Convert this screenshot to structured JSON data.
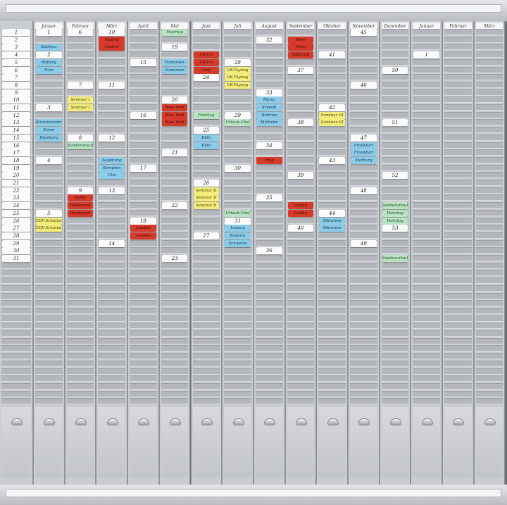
{
  "months": [
    "Januar",
    "Februar",
    "März",
    "April",
    "Mai",
    "Juni",
    "Juli",
    "August",
    "September",
    "Oktober",
    "November",
    "Dezember",
    "Januar",
    "Februar",
    "März"
  ],
  "days": [
    "1",
    "2",
    "3",
    "4",
    "5",
    "6",
    "7",
    "8",
    "9",
    "10",
    "11",
    "12",
    "13",
    "14",
    "15",
    "16",
    "17",
    "18",
    "19",
    "20",
    "21",
    "22",
    "23",
    "24",
    "25",
    "26",
    "27",
    "28",
    "29",
    "30",
    "31"
  ],
  "cards": [
    {
      "col": 0,
      "row": 0,
      "text": "1",
      "color": "white"
    },
    {
      "col": 0,
      "row": 2,
      "text": "Koblenz",
      "color": "blue"
    },
    {
      "col": 0,
      "row": 3,
      "text": "2",
      "color": "white"
    },
    {
      "col": 0,
      "row": 4,
      "text": "Bitburg",
      "color": "blue"
    },
    {
      "col": 0,
      "row": 5,
      "text": "Trier",
      "color": "blue"
    },
    {
      "col": 0,
      "row": 10,
      "text": "3",
      "color": "white"
    },
    {
      "col": 0,
      "row": 12,
      "text": "Kaiserslautern",
      "color": "blue"
    },
    {
      "col": 0,
      "row": 13,
      "text": "Essen",
      "color": "blue"
    },
    {
      "col": 0,
      "row": 14,
      "text": "Duisburg",
      "color": "blue"
    },
    {
      "col": 0,
      "row": 17,
      "text": "4",
      "color": "white"
    },
    {
      "col": 0,
      "row": 24,
      "text": "5",
      "color": "white"
    },
    {
      "col": 0,
      "row": 25,
      "text": "EDV-Schulung",
      "color": "yellow"
    },
    {
      "col": 0,
      "row": 26,
      "text": "EDV-Schulung",
      "color": "yellow"
    },
    {
      "col": 1,
      "row": 0,
      "text": "6",
      "color": "white"
    },
    {
      "col": 1,
      "row": 7,
      "text": "7",
      "color": "white"
    },
    {
      "col": 1,
      "row": 9,
      "text": "Seminar I",
      "color": "yellow"
    },
    {
      "col": 1,
      "row": 10,
      "text": "Seminar I",
      "color": "yellow"
    },
    {
      "col": 1,
      "row": 14,
      "text": "8",
      "color": "white"
    },
    {
      "col": 1,
      "row": 15,
      "text": "Sonderurlaub",
      "color": "green"
    },
    {
      "col": 1,
      "row": 21,
      "text": "9",
      "color": "white"
    },
    {
      "col": 1,
      "row": 22,
      "text": "Venlo",
      "color": "red"
    },
    {
      "col": 1,
      "row": 23,
      "text": "Roermond",
      "color": "red"
    },
    {
      "col": 1,
      "row": 24,
      "text": "Roermond",
      "color": "red"
    },
    {
      "col": 2,
      "row": 0,
      "text": "10",
      "color": "white"
    },
    {
      "col": 2,
      "row": 1,
      "text": "Madrid",
      "color": "red"
    },
    {
      "col": 2,
      "row": 2,
      "text": "Madrid",
      "color": "red"
    },
    {
      "col": 2,
      "row": 7,
      "text": "11",
      "color": "white"
    },
    {
      "col": 2,
      "row": 14,
      "text": "12",
      "color": "white"
    },
    {
      "col": 2,
      "row": 17,
      "text": "Augsburg",
      "color": "blue"
    },
    {
      "col": 2,
      "row": 18,
      "text": "Kempten",
      "color": "blue"
    },
    {
      "col": 2,
      "row": 19,
      "text": "Ulm",
      "color": "blue"
    },
    {
      "col": 2,
      "row": 21,
      "text": "13",
      "color": "white"
    },
    {
      "col": 2,
      "row": 28,
      "text": "14",
      "color": "white"
    },
    {
      "col": 3,
      "row": 4,
      "text": "15",
      "color": "white"
    },
    {
      "col": 3,
      "row": 11,
      "text": "16",
      "color": "white"
    },
    {
      "col": 3,
      "row": 18,
      "text": "17",
      "color": "white"
    },
    {
      "col": 3,
      "row": 25,
      "text": "18",
      "color": "white"
    },
    {
      "col": 3,
      "row": 26,
      "text": "London",
      "color": "red"
    },
    {
      "col": 3,
      "row": 27,
      "text": "London",
      "color": "red"
    },
    {
      "col": 4,
      "row": 0,
      "text": "Feiertag",
      "color": "green"
    },
    {
      "col": 4,
      "row": 2,
      "text": "19",
      "color": "white"
    },
    {
      "col": 4,
      "row": 4,
      "text": "Hannover",
      "color": "blue"
    },
    {
      "col": 4,
      "row": 5,
      "text": "Hannover",
      "color": "blue"
    },
    {
      "col": 4,
      "row": 9,
      "text": "20",
      "color": "white"
    },
    {
      "col": 4,
      "row": 10,
      "text": "New York",
      "color": "red"
    },
    {
      "col": 4,
      "row": 11,
      "text": "New York",
      "color": "red"
    },
    {
      "col": 4,
      "row": 12,
      "text": "New York",
      "color": "red"
    },
    {
      "col": 4,
      "row": 16,
      "text": "21",
      "color": "white"
    },
    {
      "col": 4,
      "row": 23,
      "text": "22",
      "color": "white"
    },
    {
      "col": 4,
      "row": 30,
      "text": "23",
      "color": "white"
    },
    {
      "col": 5,
      "row": 3,
      "text": "Zürich",
      "color": "red"
    },
    {
      "col": 5,
      "row": 4,
      "text": "Zürich",
      "color": "red"
    },
    {
      "col": 5,
      "row": 5,
      "text": "Genf",
      "color": "red"
    },
    {
      "col": 5,
      "row": 6,
      "text": "24",
      "color": "white"
    },
    {
      "col": 5,
      "row": 11,
      "text": "Feiertag",
      "color": "green"
    },
    {
      "col": 5,
      "row": 13,
      "text": "25",
      "color": "white"
    },
    {
      "col": 5,
      "row": 14,
      "text": "Köln",
      "color": "blue"
    },
    {
      "col": 5,
      "row": 15,
      "text": "Köln",
      "color": "blue"
    },
    {
      "col": 5,
      "row": 20,
      "text": "26",
      "color": "white"
    },
    {
      "col": 5,
      "row": 21,
      "text": "Seminar II",
      "color": "yellow"
    },
    {
      "col": 5,
      "row": 22,
      "text": "Seminar II",
      "color": "yellow"
    },
    {
      "col": 5,
      "row": 23,
      "text": "Seminar II",
      "color": "yellow"
    },
    {
      "col": 5,
      "row": 27,
      "text": "27",
      "color": "white"
    },
    {
      "col": 6,
      "row": 4,
      "text": "28",
      "color": "white"
    },
    {
      "col": 6,
      "row": 5,
      "text": "VK-Tagung",
      "color": "yellow"
    },
    {
      "col": 6,
      "row": 6,
      "text": "VK-Tagung",
      "color": "yellow"
    },
    {
      "col": 6,
      "row": 7,
      "text": "VK-Tagung",
      "color": "yellow"
    },
    {
      "col": 6,
      "row": 11,
      "text": "29",
      "color": "white"
    },
    {
      "col": 6,
      "row": 12,
      "text": "Urlaub-Chef",
      "color": "green"
    },
    {
      "col": 6,
      "row": 18,
      "text": "30",
      "color": "white"
    },
    {
      "col": 6,
      "row": 24,
      "text": "Urlaub-Chef",
      "color": "green"
    },
    {
      "col": 6,
      "row": 25,
      "text": "31",
      "color": "white"
    },
    {
      "col": 6,
      "row": 26,
      "text": "Leipzig",
      "color": "blue"
    },
    {
      "col": 6,
      "row": 27,
      "text": "Rostock",
      "color": "blue"
    },
    {
      "col": 6,
      "row": 28,
      "text": "Schwerin",
      "color": "blue"
    },
    {
      "col": 7,
      "row": 1,
      "text": "32",
      "color": "white"
    },
    {
      "col": 7,
      "row": 8,
      "text": "33",
      "color": "white"
    },
    {
      "col": 7,
      "row": 9,
      "text": "Mainz",
      "color": "blue"
    },
    {
      "col": 7,
      "row": 10,
      "text": "Krefeld",
      "color": "blue"
    },
    {
      "col": 7,
      "row": 11,
      "text": "Bottrop",
      "color": "blue"
    },
    {
      "col": 7,
      "row": 12,
      "text": "Mülheim",
      "color": "blue"
    },
    {
      "col": 7,
      "row": 15,
      "text": "34",
      "color": "white"
    },
    {
      "col": 7,
      "row": 17,
      "text": "Prag",
      "color": "red"
    },
    {
      "col": 7,
      "row": 22,
      "text": "35",
      "color": "white"
    },
    {
      "col": 7,
      "row": 29,
      "text": "36",
      "color": "white"
    },
    {
      "col": 8,
      "row": 1,
      "text": "Wien",
      "color": "red"
    },
    {
      "col": 8,
      "row": 2,
      "text": "Wien",
      "color": "red"
    },
    {
      "col": 8,
      "row": 3,
      "text": "Salzburg",
      "color": "red"
    },
    {
      "col": 8,
      "row": 5,
      "text": "37",
      "color": "white"
    },
    {
      "col": 8,
      "row": 12,
      "text": "38",
      "color": "white"
    },
    {
      "col": 8,
      "row": 19,
      "text": "39",
      "color": "white"
    },
    {
      "col": 8,
      "row": 23,
      "text": "Dublin",
      "color": "red"
    },
    {
      "col": 8,
      "row": 24,
      "text": "Dublin",
      "color": "red"
    },
    {
      "col": 8,
      "row": 26,
      "text": "40",
      "color": "white"
    },
    {
      "col": 9,
      "row": 3,
      "text": "41",
      "color": "white"
    },
    {
      "col": 9,
      "row": 10,
      "text": "42",
      "color": "white"
    },
    {
      "col": 9,
      "row": 11,
      "text": "Seminar III",
      "color": "yellow"
    },
    {
      "col": 9,
      "row": 12,
      "text": "Seminar III",
      "color": "yellow"
    },
    {
      "col": 9,
      "row": 17,
      "text": "43",
      "color": "white"
    },
    {
      "col": 9,
      "row": 24,
      "text": "44",
      "color": "white"
    },
    {
      "col": 9,
      "row": 25,
      "text": "München",
      "color": "blue"
    },
    {
      "col": 9,
      "row": 26,
      "text": "München",
      "color": "blue"
    },
    {
      "col": 10,
      "row": 0,
      "text": "45",
      "color": "white"
    },
    {
      "col": 10,
      "row": 7,
      "text": "46",
      "color": "white"
    },
    {
      "col": 10,
      "row": 14,
      "text": "47",
      "color": "white"
    },
    {
      "col": 10,
      "row": 15,
      "text": "Frankfurt",
      "color": "blue"
    },
    {
      "col": 10,
      "row": 16,
      "text": "Frankfurt",
      "color": "blue"
    },
    {
      "col": 10,
      "row": 17,
      "text": "Marburg",
      "color": "blue"
    },
    {
      "col": 10,
      "row": 21,
      "text": "48",
      "color": "white"
    },
    {
      "col": 10,
      "row": 28,
      "text": "49",
      "color": "white"
    },
    {
      "col": 11,
      "row": 5,
      "text": "50",
      "color": "white"
    },
    {
      "col": 11,
      "row": 12,
      "text": "51",
      "color": "white"
    },
    {
      "col": 11,
      "row": 19,
      "text": "52",
      "color": "white"
    },
    {
      "col": 11,
      "row": 23,
      "text": "Sonderurlaub",
      "color": "green"
    },
    {
      "col": 11,
      "row": 24,
      "text": "Feiertag",
      "color": "green"
    },
    {
      "col": 11,
      "row": 25,
      "text": "Feiertag",
      "color": "green"
    },
    {
      "col": 11,
      "row": 26,
      "text": "53",
      "color": "white"
    },
    {
      "col": 11,
      "row": 30,
      "text": "Sonderurlaub",
      "color": "green"
    },
    {
      "col": 12,
      "row": 3,
      "text": "1",
      "color": "white"
    }
  ]
}
